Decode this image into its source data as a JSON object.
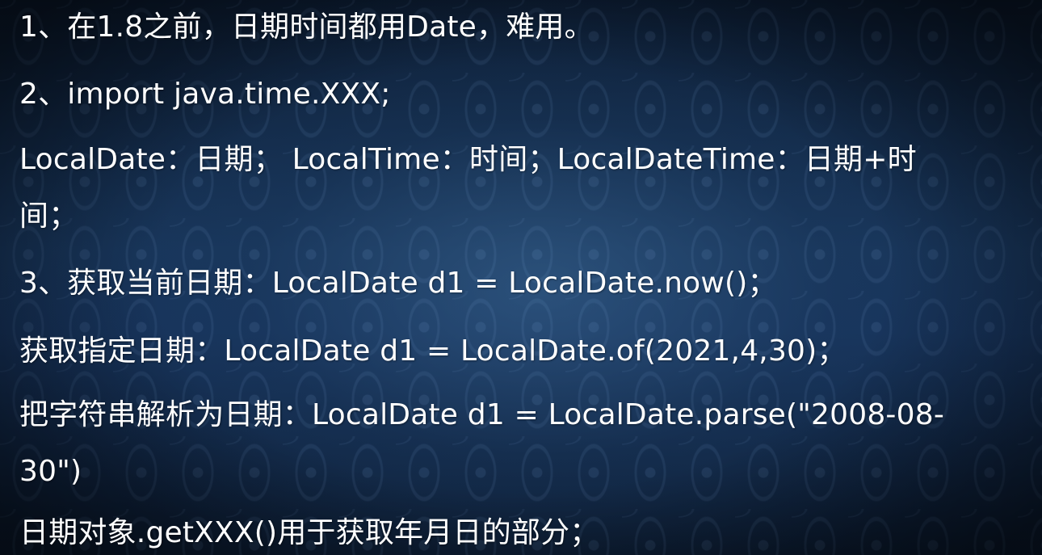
{
  "slide": {
    "lines": [
      "1、在1.8之前，日期时间都用Date，难用。",
      "2、import java.time.XXX;",
      "LocalDate：日期； LocalTime：时间；LocalDateTime：日期+时",
      "间；",
      "3、获取当前日期：LocalDate d1 = LocalDate.now()；",
      "获取指定日期：LocalDate d1 = LocalDate.of(2021,4,30)；",
      "把字符串解析为日期：LocalDate d1 = LocalDate.parse(\"2008-08-",
      "30\")",
      "日期对象.getXXX()用于获取年月日的部分；"
    ]
  }
}
